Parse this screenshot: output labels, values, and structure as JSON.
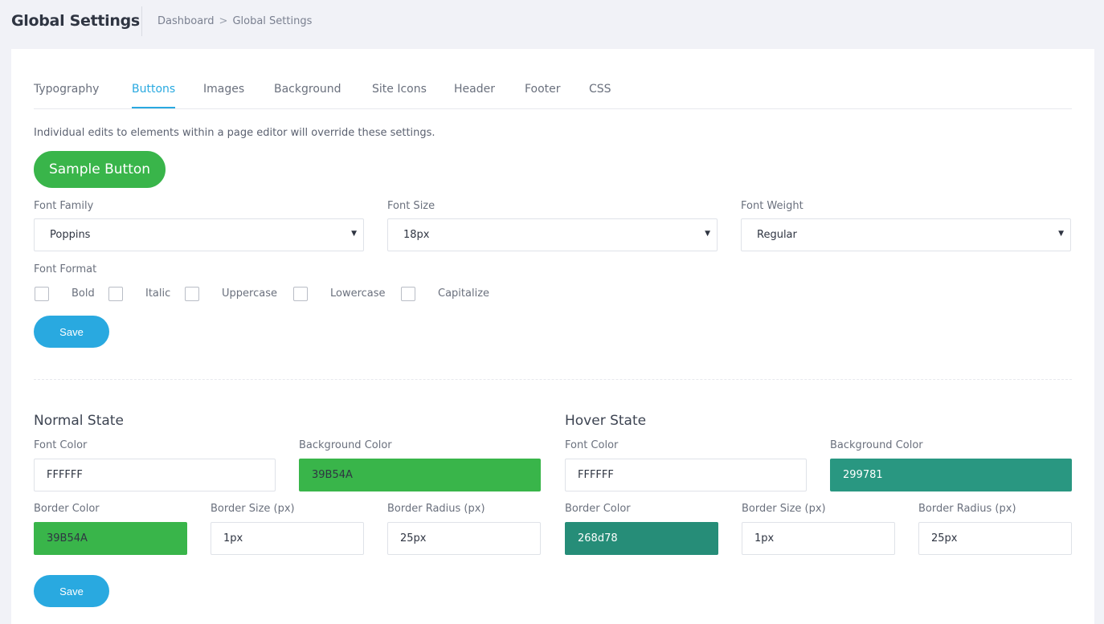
{
  "header": {
    "title": "Global Settings",
    "breadcrumb": [
      "Dashboard",
      "Global Settings"
    ],
    "breadcrumb_separator": ">"
  },
  "tabs": [
    {
      "label": "Typography",
      "active": false
    },
    {
      "label": "Buttons",
      "active": true
    },
    {
      "label": "Images",
      "active": false
    },
    {
      "label": "Background",
      "active": false
    },
    {
      "label": "Site Icons",
      "active": false
    },
    {
      "label": "Header",
      "active": false
    },
    {
      "label": "Footer",
      "active": false
    },
    {
      "label": "CSS",
      "active": false
    }
  ],
  "note": "Individual edits to elements within a page editor will override these settings.",
  "sample_button": {
    "label": "Sample Button"
  },
  "typography": {
    "font_family": {
      "label": "Font Family",
      "value": "Poppins"
    },
    "font_size": {
      "label": "Font Size",
      "value": "18px"
    },
    "font_weight": {
      "label": "Font Weight",
      "value": "Regular"
    },
    "font_format": {
      "label": "Font Format",
      "options": [
        {
          "label": "Bold",
          "checked": false
        },
        {
          "label": "Italic",
          "checked": false
        },
        {
          "label": "Uppercase",
          "checked": false
        },
        {
          "label": "Lowercase",
          "checked": false
        },
        {
          "label": "Capitalize",
          "checked": false
        }
      ]
    },
    "save_label": "Save"
  },
  "normal_state": {
    "title": "Normal State",
    "font_color": {
      "label": "Font Color",
      "value": "FFFFFF"
    },
    "background_color": {
      "label": "Background Color",
      "value": "39B54A",
      "swatch": "#39B54A"
    },
    "border_color": {
      "label": "Border Color",
      "value": "39B54A",
      "swatch": "#39B54A"
    },
    "border_size": {
      "label": "Border Size (px)",
      "value": "1px"
    },
    "border_radius": {
      "label": "Border Radius (px)",
      "value": "25px"
    }
  },
  "hover_state": {
    "title": "Hover State",
    "font_color": {
      "label": "Font Color",
      "value": "FFFFFF"
    },
    "background_color": {
      "label": "Background Color",
      "value": "299781",
      "swatch": "#299781"
    },
    "border_color": {
      "label": "Border Color",
      "value": "268d78",
      "swatch": "#268d78"
    },
    "border_size": {
      "label": "Border Size (px)",
      "value": "1px"
    },
    "border_radius": {
      "label": "Border Radius (px)",
      "value": "25px"
    }
  },
  "states_save_label": "Save",
  "colors": {
    "accent": "#29a9e0",
    "sample_green": "#39B54A"
  },
  "icons": {
    "dropdown": "caret-down-icon"
  }
}
